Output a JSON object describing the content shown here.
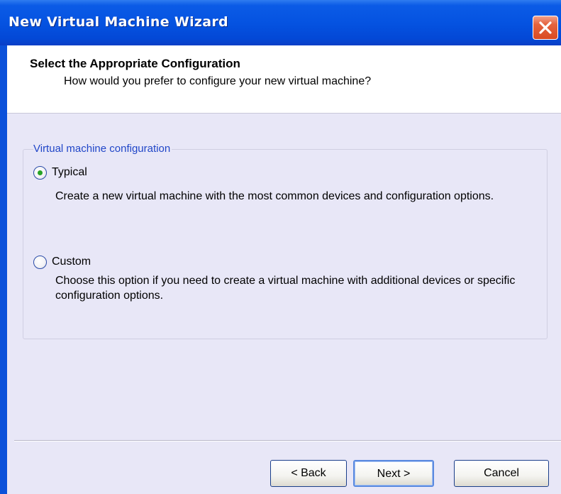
{
  "window": {
    "title": "New Virtual Machine Wizard",
    "close_icon": "close-icon"
  },
  "header": {
    "title": "Select the Appropriate Configuration",
    "subtitle": "How would you prefer to configure your new virtual machine?"
  },
  "group": {
    "legend": "Virtual machine configuration",
    "options": [
      {
        "label": "Typical",
        "description": "Create a new virtual machine with the most common devices and configuration options.",
        "selected": true
      },
      {
        "label": "Custom",
        "description": "Choose this option if you need to create a virtual machine with additional devices or specific configuration options.",
        "selected": false
      }
    ]
  },
  "buttons": {
    "back": "< Back",
    "next": "Next >",
    "cancel": "Cancel"
  },
  "colors": {
    "titlebar": "#0553e1",
    "client_background": "#e8e7f7",
    "legend_text": "#2046c8",
    "close_button": "#d94a22",
    "radio_dot": "#27a327"
  }
}
